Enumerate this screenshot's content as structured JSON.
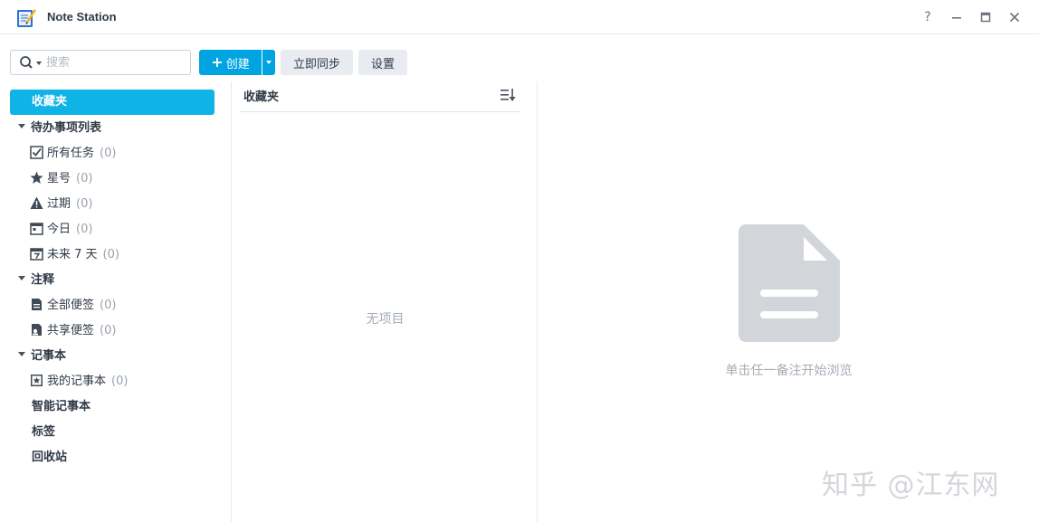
{
  "app": {
    "title": "Note Station",
    "icon": "note-station-app-icon"
  },
  "window_controls": {
    "help": "?",
    "minimize_icon": "minimize-icon",
    "maximize_icon": "maximize-icon",
    "close_icon": "close-icon"
  },
  "toolbar": {
    "search_placeholder": "搜索",
    "create_label": "创建",
    "create_plus": "+",
    "sync_label": "立即同步",
    "settings_label": "设置"
  },
  "sidebar": {
    "favorites_label": "收藏夹",
    "todo": {
      "label": "待办事项列表",
      "items": [
        {
          "label": "所有任务",
          "count": "(0)",
          "icon": "checkbox-icon"
        },
        {
          "label": "星号",
          "count": "(0)",
          "icon": "star-icon"
        },
        {
          "label": "过期",
          "count": "(0)",
          "icon": "warning-icon"
        },
        {
          "label": "今日",
          "count": "(0)",
          "icon": "calendar-icon"
        },
        {
          "label": "未来 7 天",
          "count": "(0)",
          "icon": "calendar-week-icon"
        }
      ]
    },
    "notes": {
      "label": "注释",
      "items": [
        {
          "label": "全部便签",
          "count": "(0)",
          "icon": "notes-icon"
        },
        {
          "label": "共享便签",
          "count": "(0)",
          "icon": "shared-notes-icon"
        }
      ]
    },
    "notebooks": {
      "label": "记事本",
      "items": [
        {
          "label": "我的记事本",
          "count": "(0)",
          "icon": "notebook-icon"
        }
      ]
    },
    "smart_notebooks_label": "智能记事本",
    "tags_label": "标签",
    "recycle_bin_label": "回收站"
  },
  "list": {
    "title": "收藏夹",
    "empty_text": "无项目",
    "sort_icon": "sort-icon"
  },
  "preview": {
    "hint": "单击任一备注开始浏览",
    "icon": "document-icon"
  },
  "watermark": "知乎 @江东网",
  "colors": {
    "accent": "#00a4e0",
    "selected": "#10b3e6",
    "muted_text": "#a5acb5",
    "doc_icon": "#d2d5d9"
  }
}
